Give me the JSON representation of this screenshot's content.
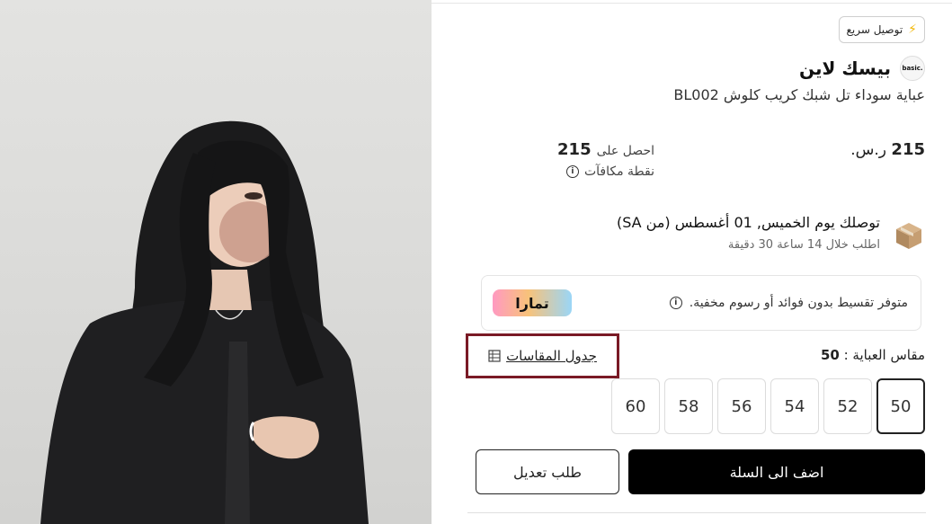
{
  "badge": {
    "label": "توصيل سريع",
    "icon": "lightning-icon"
  },
  "brand": {
    "name": "بيسك لاين",
    "logo_text": "basic."
  },
  "product": {
    "title": "عباية سوداء تل شبك كريب كلوش BL002"
  },
  "price": {
    "amount": "215",
    "currency": "ر.س."
  },
  "rewards": {
    "prefix": "احصل على",
    "points": "215",
    "label": "نقطة مكافآت"
  },
  "delivery": {
    "title": "توصلك يوم الخميس, 01 أغسطس (من SA)",
    "subtitle": "اطلب خلال 14 ساعة 30 دقيقة"
  },
  "installments": {
    "text": "متوفر تقسيط بدون فوائد أو رسوم مخفية.",
    "logo_text": "تمارا"
  },
  "size": {
    "label": "مقاس العباية :",
    "selected": "50",
    "chart_label": "جدول المقاسات",
    "options": [
      "50",
      "52",
      "54",
      "56",
      "58",
      "60"
    ]
  },
  "actions": {
    "add_to_cart": "اضف الى السلة",
    "request_edit": "طلب تعديل"
  },
  "colors": {
    "accent": "#000000",
    "highlight_border": "#7a1a25"
  }
}
